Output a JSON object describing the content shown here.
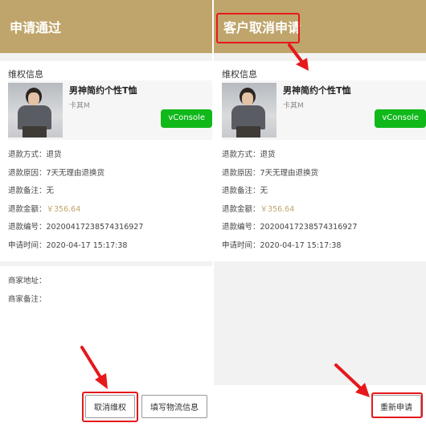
{
  "left": {
    "header_title": "申请通过",
    "section_title": "维权信息",
    "product": {
      "name": "男神简约个性T恤",
      "spec": "卡其M"
    },
    "vconsole_label": "vConsole",
    "details": [
      {
        "label": "退款方式：",
        "value": "退货"
      },
      {
        "label": "退款原因：",
        "value": "7天无理由退换货"
      },
      {
        "label": "退款备注：",
        "value": "无"
      },
      {
        "label": "退款金额：",
        "value": "￥356.64"
      },
      {
        "label": "退款编号：",
        "value": "202004172385743169​27"
      },
      {
        "label": "申请时间：",
        "value": "2020-04-17 15:17:38"
      }
    ],
    "merchant": [
      {
        "label": "商家地址：",
        "value": ""
      },
      {
        "label": "商家备注：",
        "value": ""
      }
    ],
    "buttons": {
      "cancel": "取消维权",
      "logistics": "填写物流信息"
    }
  },
  "right": {
    "header_title": "客户取消申请",
    "section_title": "维权信息",
    "product": {
      "name": "男神简约个性T恤",
      "spec": "卡其M"
    },
    "vconsole_label": "vConsole",
    "details": [
      {
        "label": "退款方式：",
        "value": "退货"
      },
      {
        "label": "退款原因：",
        "value": "7天无理由退换货"
      },
      {
        "label": "退款备注：",
        "value": "无"
      },
      {
        "label": "退款金额：",
        "value": "￥356.64"
      },
      {
        "label": "退款编号：",
        "value": "20200417238574316927"
      },
      {
        "label": "申请时间：",
        "value": "2020-04-17 15:17:38"
      }
    ],
    "buttons": {
      "reapply": "重新申请"
    }
  },
  "colors": {
    "header": "#bfa56b",
    "money": "#bfa56b",
    "vconsole": "#10b81a",
    "annotation": "#e6181c"
  }
}
